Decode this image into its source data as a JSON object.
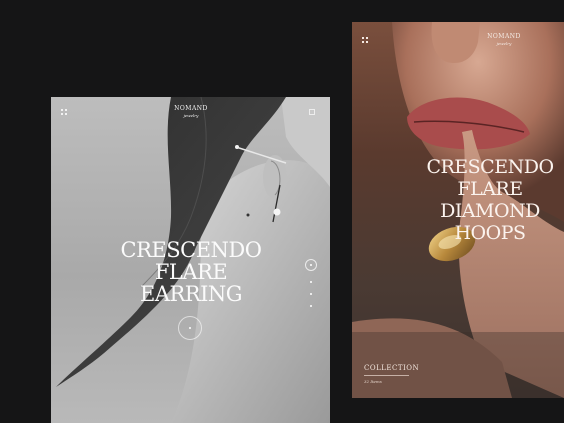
{
  "left_card": {
    "brand": "NOMAND",
    "brand_sub": "jewelry",
    "headline": [
      "CRESCENDO",
      "FLARE",
      "EARRING"
    ]
  },
  "right_card": {
    "brand": "NOMAND",
    "brand_sub": "jewelry",
    "headline": [
      "CRESCENDO",
      "FLARE",
      "DIAMOND",
      "HOOPS"
    ],
    "collection_label": "COLLECTION",
    "items_count": "32 Items"
  },
  "icons": {
    "menu": "grid-menu-icon",
    "bag": "shopping-bag-icon",
    "slider": "ring-indicator-icon"
  },
  "colors": {
    "background": "#151516",
    "headline_text": "#fbfbfb",
    "gold_ring": "#c9a25a"
  }
}
